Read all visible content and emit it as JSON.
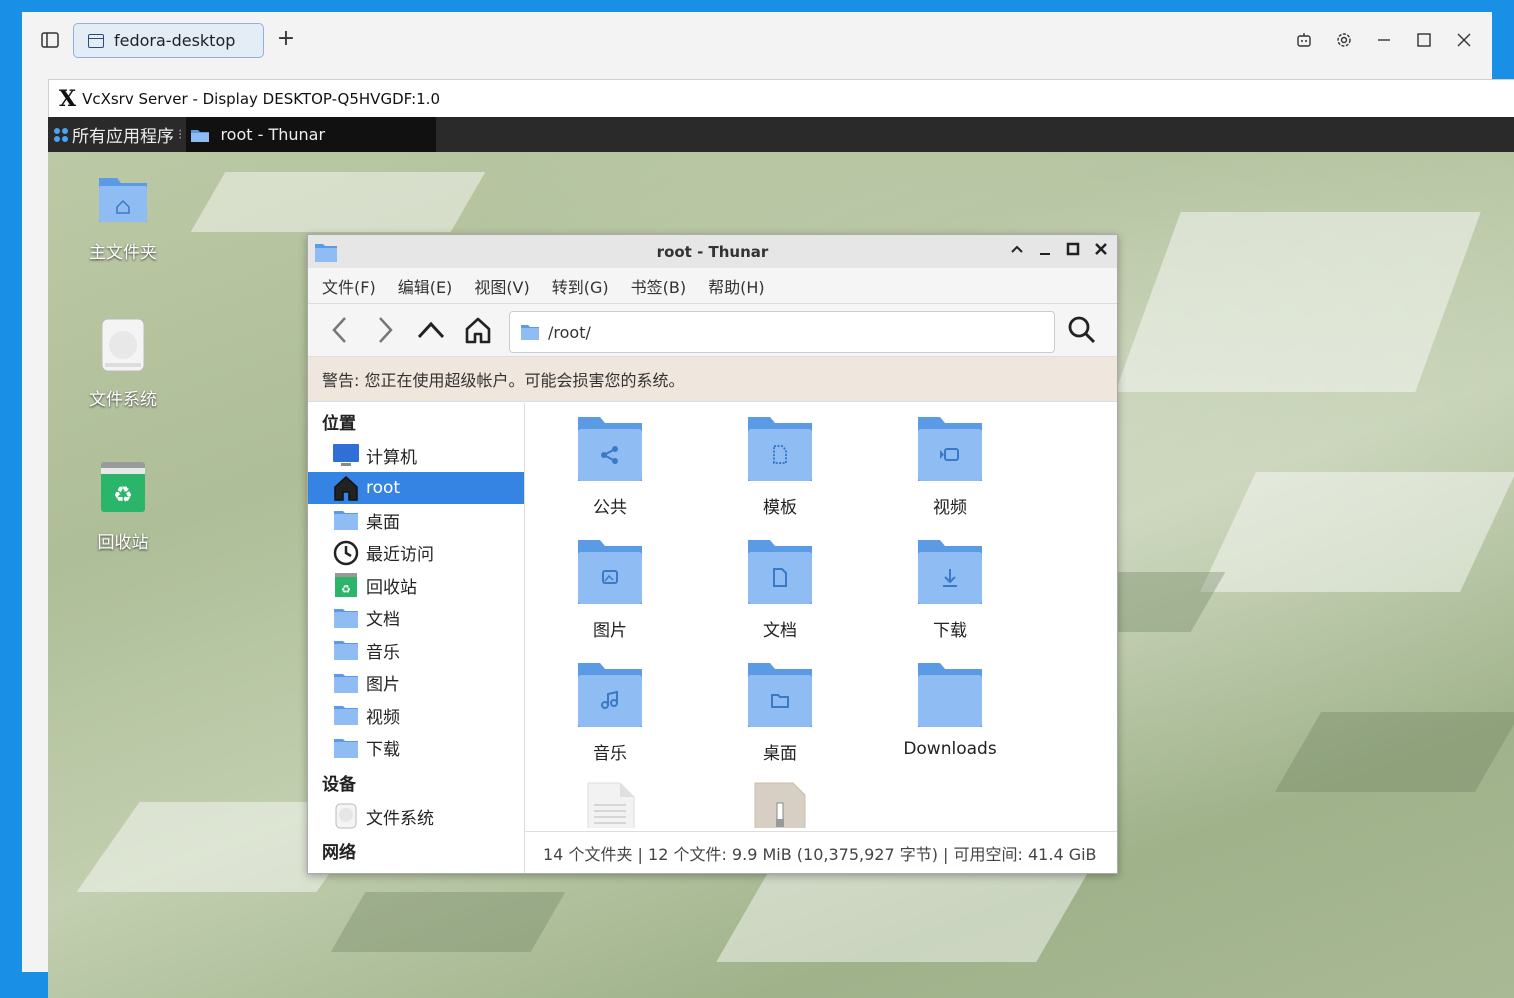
{
  "host": {
    "tab_title": "fedora-desktop",
    "add_tab": "+"
  },
  "vcxsrv": {
    "title": "VcXsrv Server - Display DESKTOP-Q5HVGDF:1.0"
  },
  "panel": {
    "apps_label": "所有应用程序",
    "task_label": "root - Thunar"
  },
  "desktop_icons": [
    {
      "label": "主文件夹",
      "icon": "home-folder-icon"
    },
    {
      "label": "文件系统",
      "icon": "drive-icon"
    },
    {
      "label": "回收站",
      "icon": "trash-icon"
    }
  ],
  "thunar": {
    "title": "root - Thunar",
    "menu": [
      "文件(F)",
      "编辑(E)",
      "视图(V)",
      "转到(G)",
      "书签(B)",
      "帮助(H)"
    ],
    "location": "/root/",
    "warning": "警告: 您正在使用超级帐户。可能会损害您的系统。",
    "sidebar": {
      "places_header": "位置",
      "places": [
        {
          "label": "计算机",
          "icon": "computer-icon"
        },
        {
          "label": "root",
          "icon": "home-icon",
          "active": true
        },
        {
          "label": "桌面",
          "icon": "desktop-folder-icon"
        },
        {
          "label": "最近访问",
          "icon": "clock-icon"
        },
        {
          "label": "回收站",
          "icon": "trash-icon"
        },
        {
          "label": "文档",
          "icon": "documents-folder-icon"
        },
        {
          "label": "音乐",
          "icon": "music-folder-icon"
        },
        {
          "label": "图片",
          "icon": "pictures-folder-icon"
        },
        {
          "label": "视频",
          "icon": "videos-folder-icon"
        },
        {
          "label": "下载",
          "icon": "downloads-folder-icon"
        }
      ],
      "devices_header": "设备",
      "devices": [
        {
          "label": "文件系统",
          "icon": "drive-icon"
        }
      ],
      "network_header": "网络"
    },
    "files": [
      {
        "label": "公共",
        "icon": "share-folder-icon"
      },
      {
        "label": "模板",
        "icon": "templates-folder-icon"
      },
      {
        "label": "视频",
        "icon": "videos-folder-icon"
      },
      {
        "label": "图片",
        "icon": "pictures-folder-icon"
      },
      {
        "label": "文档",
        "icon": "documents-folder-icon"
      },
      {
        "label": "下载",
        "icon": "downloads-folder-icon"
      },
      {
        "label": "音乐",
        "icon": "music-folder-icon"
      },
      {
        "label": "桌面",
        "icon": "desktop-folder-icon"
      },
      {
        "label": "Downloads",
        "icon": "folder-icon"
      },
      {
        "label": "",
        "icon": "text-file-icon"
      },
      {
        "label": "",
        "icon": "archive-file-icon"
      }
    ],
    "status": "14 个文件夹 | 12 个文件: 9.9 MiB (10,375,927 字节) | 可用空间: 41.4 GiB"
  },
  "colors": {
    "folder": "#5b9be6",
    "folder_light": "#8fbdf3",
    "accent": "#3584e4",
    "warning_bg": "#efe6dd"
  }
}
